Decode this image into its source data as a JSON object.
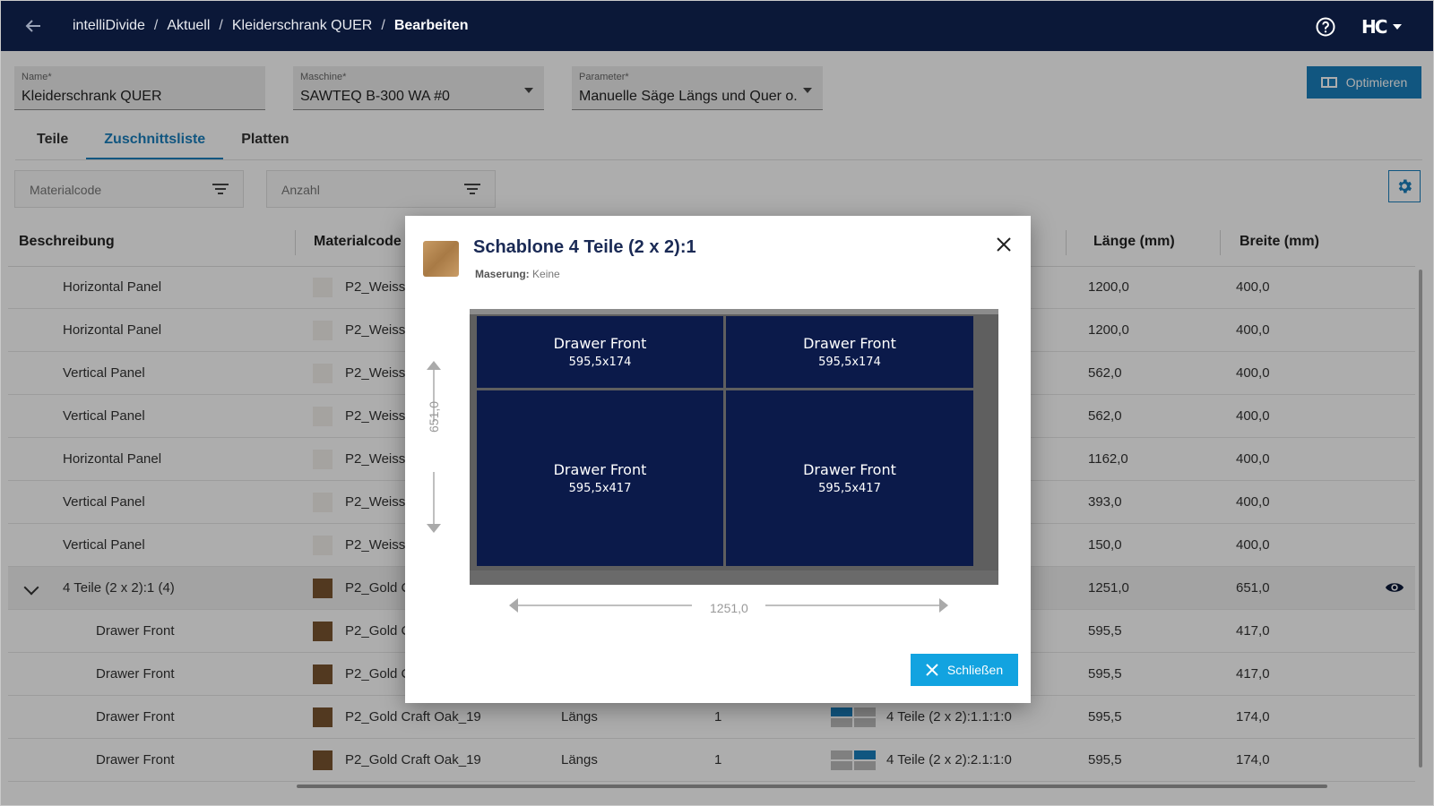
{
  "header": {
    "breadcrumbs": [
      "intelliDivide",
      "Aktuell",
      "Kleiderschrank QUER",
      "Bearbeiten"
    ],
    "user_logo": "HC"
  },
  "form": {
    "name": {
      "label": "Name*",
      "value": "Kleiderschrank QUER"
    },
    "machine": {
      "label": "Maschine*",
      "value": "SAWTEQ B-300 WA #0"
    },
    "parameter": {
      "label": "Parameter*",
      "value": "Manuelle Säge Längs und Quer o..."
    },
    "optimize_label": "Optimieren"
  },
  "tabs": [
    "Teile",
    "Zuschnittsliste",
    "Platten"
  ],
  "active_tab": "Zuschnittsliste",
  "filters": {
    "materialcode": "Materialcode",
    "anzahl": "Anzahl"
  },
  "table": {
    "headers": {
      "beschreibung": "Beschreibung",
      "materialcode": "Materialcode",
      "laenge": "Länge (mm)",
      "breite": "Breite (mm)"
    },
    "rows": [
      {
        "desc": "Horizontal Panel",
        "mat": "P2_Weiss",
        "len": "1200,0",
        "wid": "400,0"
      },
      {
        "desc": "Horizontal Panel",
        "mat": "P2_Weiss",
        "len": "1200,0",
        "wid": "400,0"
      },
      {
        "desc": "Vertical Panel",
        "mat": "P2_Weiss",
        "len": "562,0",
        "wid": "400,0"
      },
      {
        "desc": "Vertical Panel",
        "mat": "P2_Weiss",
        "len": "562,0",
        "wid": "400,0"
      },
      {
        "desc": "Horizontal Panel",
        "mat": "P2_Weiss",
        "len": "1162,0",
        "wid": "400,0"
      },
      {
        "desc": "Vertical Panel",
        "mat": "P2_Weiss",
        "len": "393,0",
        "wid": "400,0"
      },
      {
        "desc": "Vertical Panel",
        "mat": "P2_Weiss",
        "len": "150,0",
        "wid": "400,0"
      },
      {
        "desc": "4 Teile (2 x 2):1 (4)",
        "mat": "P2_Gold C",
        "len": "1251,0",
        "wid": "651,0"
      },
      {
        "desc": "Drawer Front",
        "mat": "P2_Gold C",
        "len": "595,5",
        "wid": "417,0"
      },
      {
        "desc": "Drawer Front",
        "mat": "P2_Gold C",
        "len": "595,5",
        "wid": "417,0"
      },
      {
        "desc": "Drawer Front",
        "mat": "P2_Gold Craft Oak_19",
        "grain": "Längs",
        "qty": "1",
        "pattern": "4 Teile (2 x 2):1.1:1:0",
        "len": "595,5",
        "wid": "174,0"
      },
      {
        "desc": "Drawer Front",
        "mat": "P2_Gold Craft Oak_19",
        "grain": "Längs",
        "qty": "1",
        "pattern": "4 Teile (2 x 2):2.1:1:0",
        "len": "595,5",
        "wid": "174,0"
      }
    ]
  },
  "dialog": {
    "title": "Schablone 4 Teile (2 x 2):1",
    "grain_label": "Maserung:",
    "grain_value": "Keine",
    "pieces": [
      {
        "name": "Drawer Front",
        "dim": "595,5x174"
      },
      {
        "name": "Drawer Front",
        "dim": "595,5x174"
      },
      {
        "name": "Drawer Front",
        "dim": "595,5x417"
      },
      {
        "name": "Drawer Front",
        "dim": "595,5x417"
      }
    ],
    "height_label": "651,0",
    "width_label": "1251,0",
    "close_label": "Schließen"
  },
  "colors": {
    "header_bg": "#0b1838",
    "accent": "#1a7fbd",
    "piece": "#0b1a4a",
    "close_btn": "#12a3e0"
  }
}
